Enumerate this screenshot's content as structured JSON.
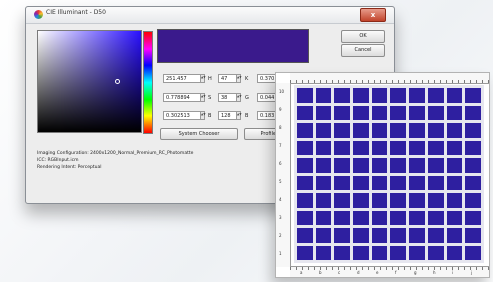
{
  "dialog": {
    "title": "CIE Illuminant - D50",
    "close_label": "x",
    "ok_label": "OK",
    "cancel_label": "Cancel",
    "system_chooser_label": "System Chooser",
    "profile_view_label": "Profile View",
    "swatch_color": "#3a1a8c",
    "fields": [
      {
        "value": "251.457",
        "label": "H",
        "value2": "47",
        "label2": "K",
        "value3": "0.370"
      },
      {
        "value": "0.778894",
        "label": "S",
        "value2": "38",
        "label2": "G",
        "value3": "0.044"
      },
      {
        "value": "0.302513",
        "label": "B",
        "value2": "128",
        "label2": "B",
        "value3": "0.183"
      }
    ],
    "info": {
      "imaging_configuration": "Imaging Configuration: 2400x1200_Normal_Premium_RC_Photomatte",
      "icc": "ICC: RGBInput.icm",
      "rendering_intent": "Rendering Intent: Perceptual"
    }
  },
  "chart": {
    "patch_color": "#2e1fa0",
    "row_labels": [
      "10",
      "9",
      "8",
      "7",
      "6",
      "5",
      "4",
      "3",
      "2",
      "1"
    ],
    "column_labels": [
      "a",
      "b",
      "c",
      "d",
      "e",
      "f",
      "g",
      "h",
      "i",
      "j"
    ]
  }
}
